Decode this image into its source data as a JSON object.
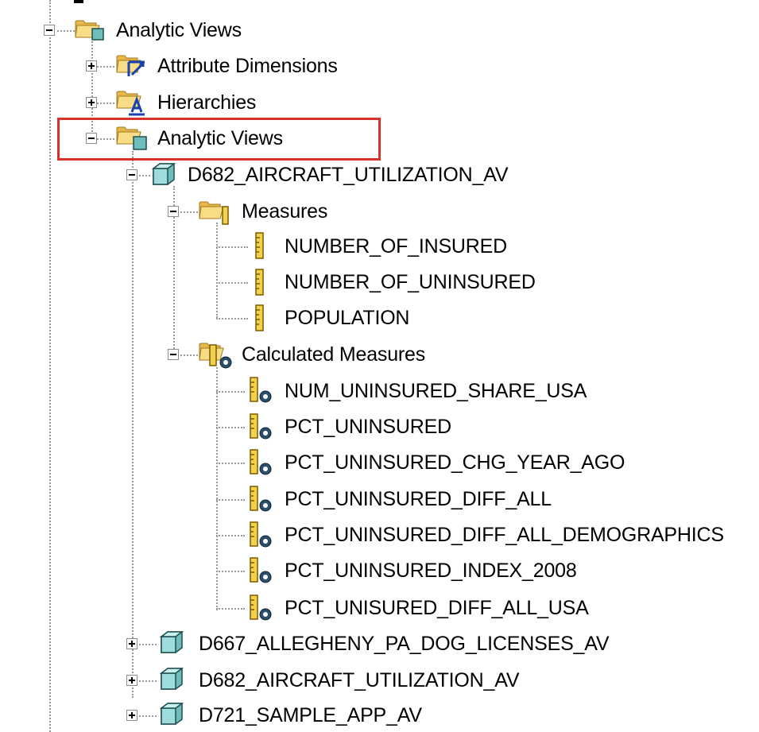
{
  "tree": {
    "root": {
      "label": "Analytic Views",
      "icon": "analytic-views-folder-icon",
      "expanded": true
    },
    "children": [
      {
        "label": "Attribute Dimensions",
        "icon": "attribute-dimensions-folder-icon",
        "expanded": false
      },
      {
        "label": "Hierarchies",
        "icon": "hierarchies-folder-icon",
        "expanded": false
      },
      {
        "label": "Analytic Views",
        "icon": "analytic-views-folder-icon",
        "expanded": true,
        "highlighted": true,
        "highlight_color": "#d9322b",
        "views": [
          {
            "label": "D682_AIRCRAFT_UTILIZATION_AV",
            "icon": "cube-icon",
            "expanded": true,
            "folders": [
              {
                "label": "Measures",
                "icon": "measures-folder-icon",
                "expanded": true,
                "items": [
                  {
                    "label": "NUMBER_OF_INSURED",
                    "icon": "measure-ruler-icon"
                  },
                  {
                    "label": "NUMBER_OF_UNINSURED",
                    "icon": "measure-ruler-icon"
                  },
                  {
                    "label": "POPULATION",
                    "icon": "measure-ruler-icon"
                  }
                ]
              },
              {
                "label": "Calculated Measures",
                "icon": "calculated-measures-folder-icon",
                "expanded": true,
                "items": [
                  {
                    "label": "NUM_UNINSURED_SHARE_USA",
                    "icon": "calculated-measure-icon"
                  },
                  {
                    "label": "PCT_UNINSURED",
                    "icon": "calculated-measure-icon"
                  },
                  {
                    "label": "PCT_UNINSURED_CHG_YEAR_AGO",
                    "icon": "calculated-measure-icon"
                  },
                  {
                    "label": "PCT_UNINSURED_DIFF_ALL",
                    "icon": "calculated-measure-icon"
                  },
                  {
                    "label": "PCT_UNINSURED_DIFF_ALL_DEMOGRAPHICS",
                    "icon": "calculated-measure-icon"
                  },
                  {
                    "label": "PCT_UNINSURED_INDEX_2008",
                    "icon": "calculated-measure-icon"
                  },
                  {
                    "label": "PCT_UNISURED_DIFF_ALL_USA",
                    "icon": "calculated-measure-icon"
                  }
                ]
              }
            ]
          },
          {
            "label": "D667_ALLEGHENY_PA_DOG_LICENSES_AV",
            "icon": "cube-icon",
            "expanded": false
          },
          {
            "label": "D682_AIRCRAFT_UTILIZATION_AV",
            "icon": "cube-icon",
            "expanded": false
          },
          {
            "label": "D721_SAMPLE_APP_AV",
            "icon": "cube-icon",
            "expanded": false
          }
        ]
      }
    ]
  }
}
